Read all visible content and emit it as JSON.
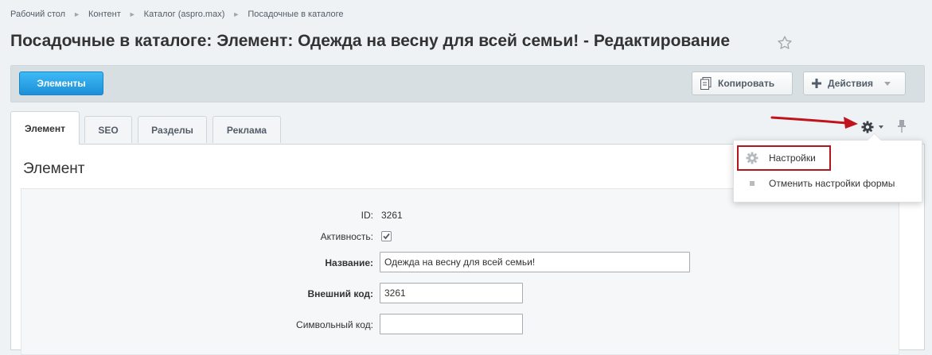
{
  "breadcrumb": [
    "Рабочий стол",
    "Контент",
    "Каталог (aspro.max)",
    "Посадочные в каталоге"
  ],
  "page_title": "Посадочные в каталоге: Элемент: Одежда на весну для всей семьи! - Редактирование",
  "toolbar": {
    "elements_label": "Элементы",
    "copy_label": "Копировать",
    "actions_label": "Действия"
  },
  "tabs": [
    "Элемент",
    "SEO",
    "Разделы",
    "Реклама"
  ],
  "panel_title": "Элемент",
  "form": {
    "id_label": "ID:",
    "id_value": "3261",
    "active_label": "Активность:",
    "active_checked": true,
    "name_label": "Название:",
    "name_value": "Одежда на весну для всей семьи!",
    "ext_code_label": "Внешний код:",
    "ext_code_value": "3261",
    "symbol_code_label": "Символьный код:",
    "symbol_code_value": ""
  },
  "menu": {
    "settings_label": "Настройки",
    "reset_label": "Отменить настройки формы"
  },
  "colors": {
    "primary_button": "#22a0e4",
    "highlight_border": "#b4151c",
    "arrow": "#c0131b"
  }
}
